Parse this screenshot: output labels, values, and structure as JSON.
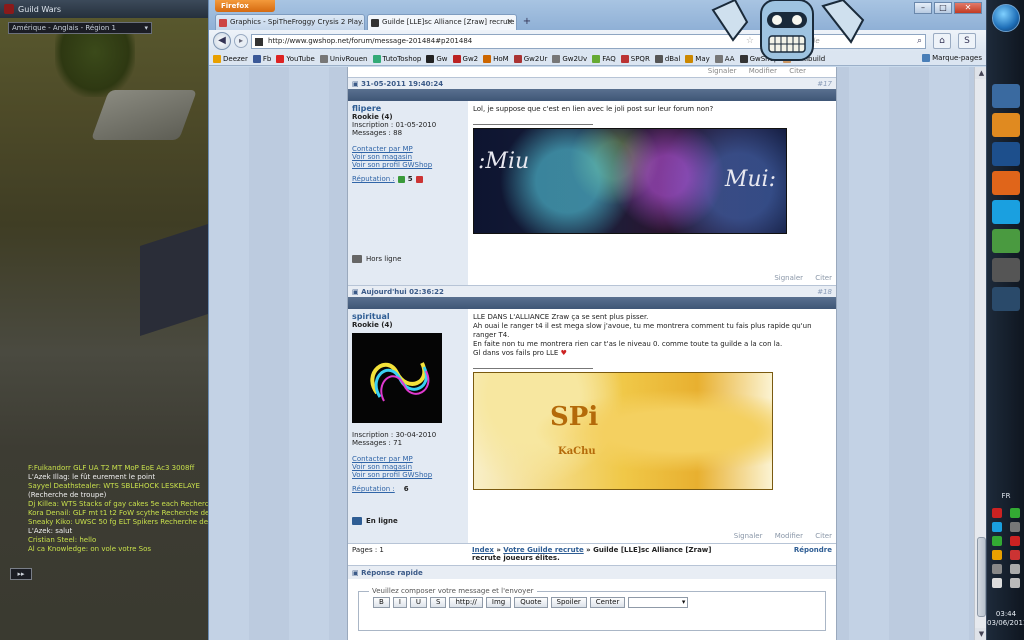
{
  "game": {
    "window_title": "Guild Wars",
    "region": "Amérique - Anglais - Région 1",
    "chat": [
      {
        "text": "F:Fuikandorr GLF UA T2 MT MoP EoE Ac3 3008ff",
        "color": "#c8e04c"
      },
      {
        "text": "L'Azek Illag: le fût eurement le point",
        "color": "#f0f0f0"
      },
      {
        "text": "Sayyel Deathstealer: WTS SBLEHOCK LESKELAYE",
        "color": "#c8e04c"
      },
      {
        "text": "(Recherche de troupe)",
        "color": "#f0f0f0"
      },
      {
        "text": "Dj Killea: WTS Stacks of gay cakes 5e each Recherche",
        "color": "#c8e04c"
      },
      {
        "text": "Kora Denail: GLF mt t1 t2 FoW scythe Recherche de",
        "color": "#c8e04c"
      },
      {
        "text": "Sneaky Kiko: UWSC 50 fg ELT Spikers Recherche de",
        "color": "#c8e04c"
      },
      {
        "text": "L'Azek: salut",
        "color": "#f0f0f0"
      },
      {
        "text": "Cristian Steel: hello",
        "color": "#c8e04c"
      },
      {
        "text": "Al ca Knowledge: on vole votre Sos",
        "color": "#c8e04c"
      }
    ],
    "chat_toggle": "▸▸"
  },
  "browser": {
    "app_button": "Firefox",
    "tabs": [
      {
        "label": "Graphics - SpiTheFroggy Crysis 2 Play...",
        "active": false
      },
      {
        "label": "Guilde [LLE]sc Alliance [Zraw] recrute ...",
        "active": true
      }
    ],
    "new_tab": "+",
    "url": "http://www.gwshop.net/forum/message-201484#p201484",
    "search_placeholder": "Google",
    "search_g": "G",
    "bookmarks": [
      {
        "label": "Deezer",
        "color": "#e8a000"
      },
      {
        "label": "Fb",
        "color": "#3b5998"
      },
      {
        "label": "YouTube",
        "color": "#d22"
      },
      {
        "label": "UnivRouen",
        "color": "#777"
      },
      {
        "label": "TutoToshop",
        "color": "#3a7"
      },
      {
        "label": "Gw",
        "color": "#222"
      },
      {
        "label": "Gw2",
        "color": "#b22"
      },
      {
        "label": "HoM",
        "color": "#c60"
      },
      {
        "label": "Gw2Ur",
        "color": "#a33"
      },
      {
        "label": "Gw2Uv",
        "color": "#777"
      },
      {
        "label": "FAQ",
        "color": "#6a3"
      },
      {
        "label": "SPQR",
        "color": "#b33"
      },
      {
        "label": "dBal",
        "color": "#555"
      },
      {
        "label": "May",
        "color": "#c80"
      },
      {
        "label": "AA",
        "color": "#777"
      },
      {
        "label": "GwShop",
        "color": "#333"
      },
      {
        "label": "Wikibuild",
        "color": "#c96"
      }
    ],
    "bookmarks_menu": "Marque-pages",
    "win": {
      "min": "–",
      "max": "□",
      "close": "✕"
    }
  },
  "forum": {
    "top_actions": [
      "Signaler",
      "Modifier",
      "Citer"
    ],
    "posts": [
      {
        "date": "31-05-2011 19:40:24",
        "num": "#17",
        "user": "flipere",
        "rank": "Rookie (4)",
        "inscription": "Inscription : 01-05-2010",
        "messages": "Messages : 88",
        "links": [
          "Contacter par MP",
          "Voir son magasin",
          "Voir son profil GWShop"
        ],
        "reputation_label": "Réputation :",
        "reputation_value": "5",
        "status": "Hors ligne",
        "lines": [
          "Lol, je suppose que c'est en lien avec le joli post sur leur forum non?"
        ],
        "banner_left": ":Miu",
        "banner_right": "Mui:",
        "footer": [
          "Signaler",
          "Citer"
        ]
      },
      {
        "date": "Aujourd'hui 02:36:22",
        "num": "#18",
        "user": "spiritual",
        "rank": "Rookie (4)",
        "inscription": "Inscription : 30-04-2010",
        "messages": "Messages : 71",
        "links": [
          "Contacter par MP",
          "Voir son magasin",
          "Voir son profil GWShop"
        ],
        "reputation_label": "Réputation :",
        "reputation_value": "6",
        "status": "En ligne",
        "lines": [
          "LLE DANS L'ALLIANCE Zraw ça se sent plus pisser.",
          "Ah ouai le ranger t4 il est mega  slow j'avoue, tu me montrera  comment tu fais plus rapide qu'un",
          "ranger T4.",
          "En faite non tu me montrera rien car t'as le niveau 0. comme toute ta guilde a la con la.",
          "Gl dans vos fails pro LLE"
        ],
        "banner_title": "SPi",
        "banner_sub": "KaChu",
        "footer": [
          "Signaler",
          "Modifier",
          "Citer"
        ]
      }
    ],
    "pager": {
      "pages": "Pages : 1",
      "crumb_index": "Index",
      "crumb_sep1": "»",
      "crumb_section": "Votre Guilde recrute",
      "crumb_sep2": "»",
      "crumb_topic": "Guilde [LLE]sc Alliance [Zraw] recrute joueurs élites.",
      "reply": "Répondre"
    },
    "quick_reply": {
      "title": "Réponse rapide",
      "legend": "Veuillez composer votre message et l'envoyer",
      "buttons": [
        "B",
        "I",
        "U",
        "S",
        "http://",
        "Img",
        "Quote",
        "Spoiler",
        "Center"
      ]
    }
  },
  "taskbar": {
    "lang": "FR",
    "time": "03:44",
    "date": "03/06/2011",
    "icons": [
      {
        "name": "windows-media-icon",
        "color": "#3a6aa0"
      },
      {
        "name": "media-player-icon",
        "color": "#e08a20"
      },
      {
        "name": "photoshop-icon",
        "color": "#1d4f8c"
      },
      {
        "name": "firefox-icon",
        "color": "#e0651a"
      },
      {
        "name": "skype-icon",
        "color": "#1aa0e0"
      },
      {
        "name": "network-icon",
        "color": "#4a9a40"
      },
      {
        "name": "guild-wars-icon",
        "color": "#555"
      },
      {
        "name": "teamspeak-icon",
        "color": "#2a4a6a"
      }
    ]
  }
}
